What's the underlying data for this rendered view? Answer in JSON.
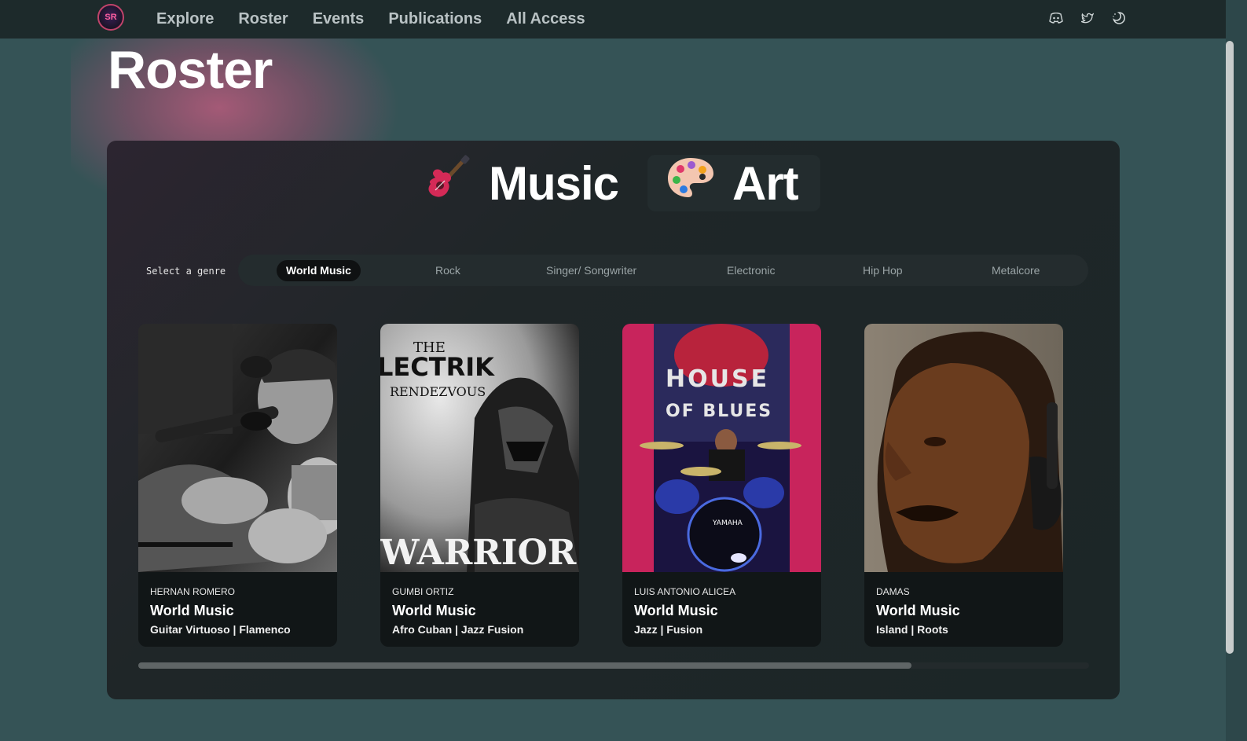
{
  "nav": {
    "logo_text": "SR",
    "links": [
      "Explore",
      "Roster",
      "Events",
      "Publications",
      "All Access"
    ],
    "social_icons": [
      "discord-icon",
      "twitter-icon",
      "theme-toggle-icon"
    ]
  },
  "page": {
    "title": "Roster"
  },
  "categories": [
    {
      "label": "Music",
      "icon": "guitar-icon"
    },
    {
      "label": "Art",
      "icon": "palette-icon"
    }
  ],
  "genre_select": {
    "label": "Select a genre",
    "options": [
      "World Music",
      "Rock",
      "Singer/ Songwriter",
      "Electronic",
      "Hip Hop",
      "Metalcore"
    ],
    "selected": "World Music"
  },
  "cards": [
    {
      "name": "HERNAN ROMERO",
      "genre": "World Music",
      "sub": "Guitar Virtuoso | Flamenco"
    },
    {
      "name": "GUMBI ORTIZ",
      "genre": "World Music",
      "sub": "Afro Cuban | Jazz Fusion",
      "image_text": {
        "top": "THE",
        "brand": "LECTRIK",
        "mid": "RENDEZVOUS",
        "bottom": "WARRIOR"
      }
    },
    {
      "name": "LUIS ANTONIO ALICEA",
      "genre": "World Music",
      "sub": "Jazz | Fusion",
      "image_text": {
        "line1": "HOUSE",
        "line2": "OF BLUES"
      }
    },
    {
      "name": "DAMAS",
      "genre": "World Music",
      "sub": "Island | Roots"
    }
  ],
  "colors": {
    "background": "#355356",
    "topbar": "#1d2a2b",
    "panel": "#1f2628",
    "accent_pink": "#c0436a"
  }
}
